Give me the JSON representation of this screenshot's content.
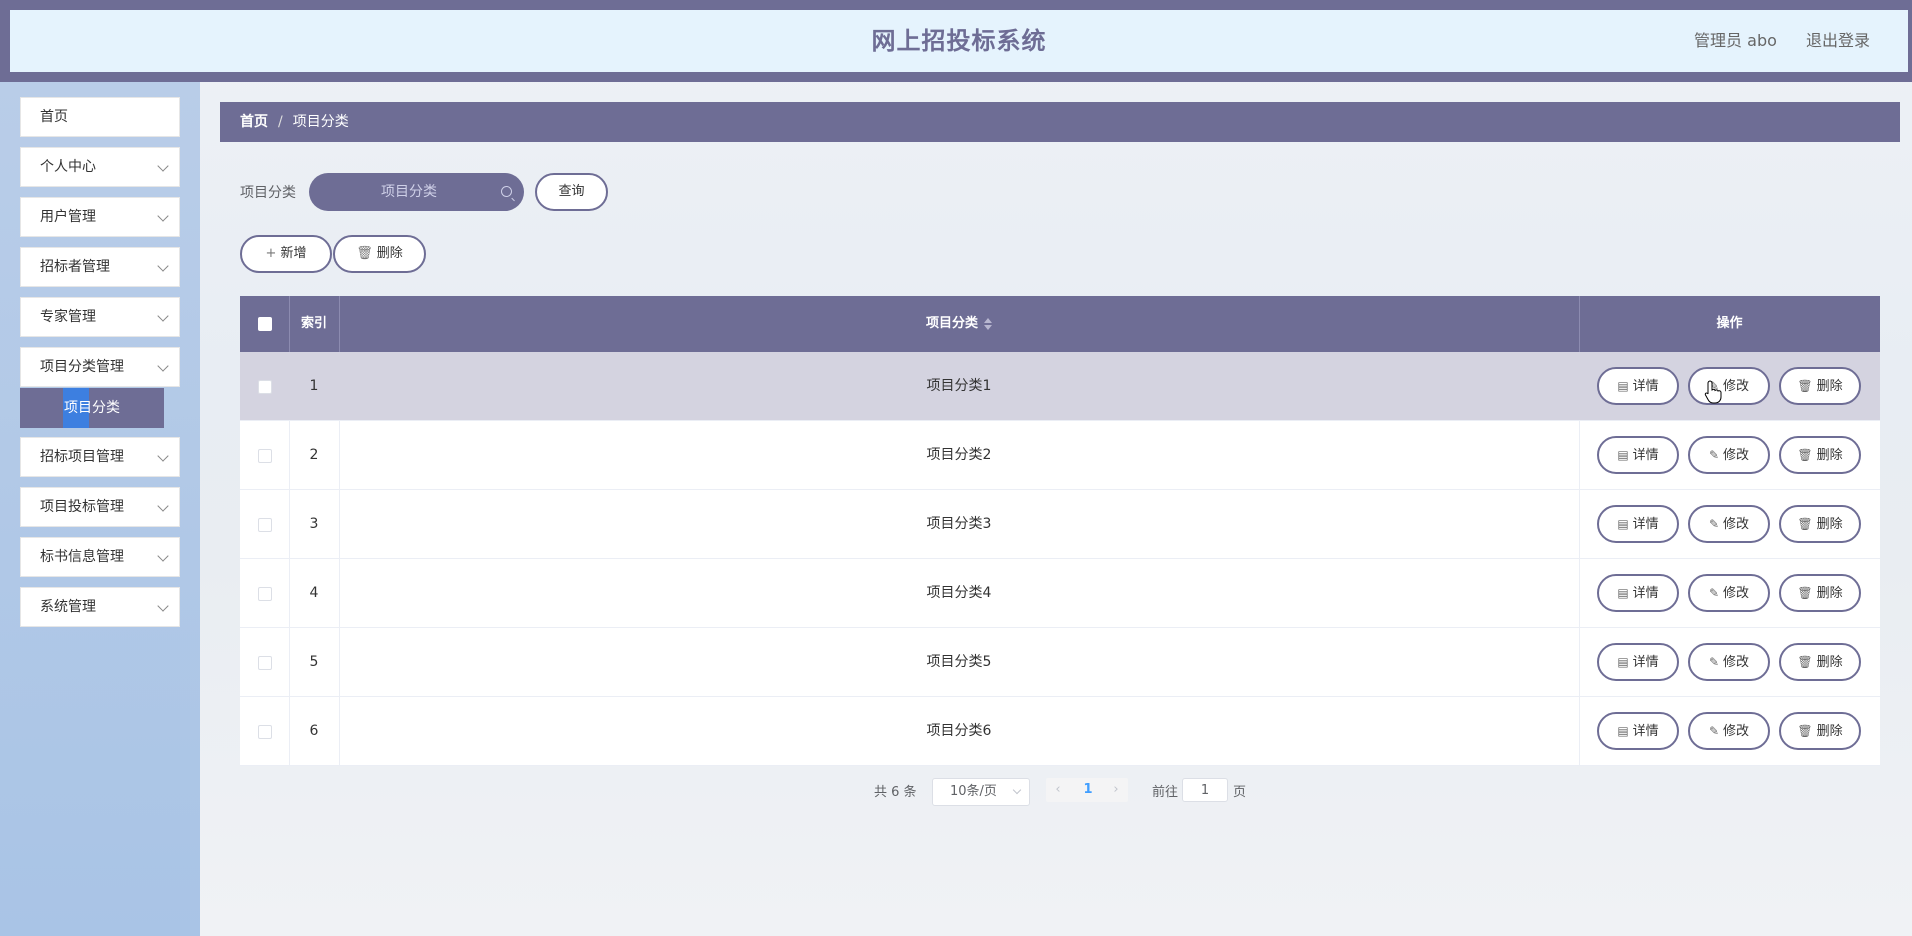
{
  "header": {
    "title": "网上招投标系统",
    "user_label": "管理员 abo",
    "logout_label": "退出登录"
  },
  "sidebar": {
    "items": [
      {
        "label": "首页",
        "has_arrow": false
      },
      {
        "label": "个人中心",
        "has_arrow": true
      },
      {
        "label": "用户管理",
        "has_arrow": true
      },
      {
        "label": "招标者管理",
        "has_arrow": true
      },
      {
        "label": "专家管理",
        "has_arrow": true
      },
      {
        "label": "项目分类管理",
        "has_arrow": true
      },
      {
        "label": "招标项目管理",
        "has_arrow": true
      },
      {
        "label": "项目投标管理",
        "has_arrow": true
      },
      {
        "label": "标书信息管理",
        "has_arrow": true
      },
      {
        "label": "系统管理",
        "has_arrow": true
      }
    ],
    "active_submenu": "项目分类"
  },
  "breadcrumb": {
    "home": "首页",
    "separator": "/",
    "current": "项目分类"
  },
  "search": {
    "label": "项目分类",
    "placeholder": "项目分类",
    "query_button": "查询"
  },
  "toolbar": {
    "add_label": "新增",
    "delete_label": "删除"
  },
  "table": {
    "columns": {
      "index": "索引",
      "category": "项目分类",
      "actions": "操作"
    },
    "rows": [
      {
        "index": "1",
        "category": "项目分类1"
      },
      {
        "index": "2",
        "category": "项目分类2"
      },
      {
        "index": "3",
        "category": "项目分类3"
      },
      {
        "index": "4",
        "category": "项目分类4"
      },
      {
        "index": "5",
        "category": "项目分类5"
      },
      {
        "index": "6",
        "category": "项目分类6"
      }
    ],
    "row_actions": {
      "detail": "详情",
      "edit": "修改",
      "delete": "删除"
    }
  },
  "pagination": {
    "total": "共 6 条",
    "page_size": "10条/页",
    "current_page": "1",
    "goto_label": "前往",
    "goto_value": "1",
    "page_suffix": "页"
  },
  "colors": {
    "primary": "#6e6d95",
    "header_bg": "#e5f3fd",
    "sidebar_bg": "#b9cde8",
    "active_highlight": "#3d7fe0"
  }
}
